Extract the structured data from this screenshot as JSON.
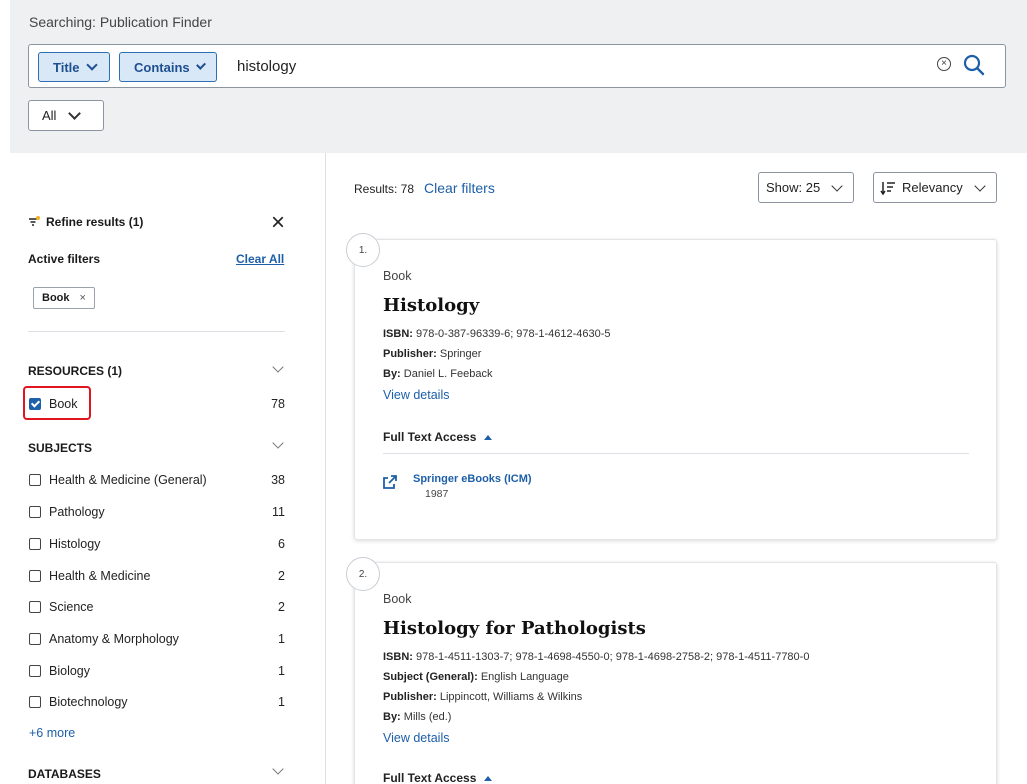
{
  "header": {
    "searching_label": "Searching: Publication Finder",
    "field_select": "Title",
    "operator_select": "Contains",
    "query": "histology",
    "clear_symbol": "⊗",
    "scope_select": "All"
  },
  "sidebar": {
    "refine_title": "Refine results (1)",
    "active_filters_label": "Active filters",
    "clear_all_label": "Clear All",
    "active_chip": "Book",
    "chip_remove": "×",
    "facets": [
      {
        "heading": "RESOURCES (1)",
        "items": [
          {
            "label": "Book",
            "count": "78",
            "checked": true
          }
        ]
      },
      {
        "heading": "SUBJECTS",
        "items": [
          {
            "label": "Health & Medicine (General)",
            "count": "38",
            "checked": false
          },
          {
            "label": "Pathology",
            "count": "11",
            "checked": false
          },
          {
            "label": "Histology",
            "count": "6",
            "checked": false
          },
          {
            "label": "Health & Medicine",
            "count": "2",
            "checked": false
          },
          {
            "label": "Science",
            "count": "2",
            "checked": false
          },
          {
            "label": "Anatomy & Morphology",
            "count": "1",
            "checked": false
          },
          {
            "label": "Biology",
            "count": "1",
            "checked": false
          },
          {
            "label": "Biotechnology",
            "count": "1",
            "checked": false
          }
        ],
        "more_label": "+6 more"
      },
      {
        "heading": "DATABASES"
      }
    ]
  },
  "results": {
    "count_label": "Results: 78",
    "clear_filters_label": "Clear filters",
    "show_label": "Show: 25",
    "sort_label": "Relevancy",
    "items": [
      {
        "number": "1.",
        "type": "Book",
        "title": "Histology",
        "meta": [
          {
            "key": "ISBN:",
            "value": "978-0-387-96339-6; 978-1-4612-4630-5"
          },
          {
            "key": "Publisher:",
            "value": "Springer"
          },
          {
            "key": "By:",
            "value": "Daniel L. Feeback"
          }
        ],
        "view_details": "View details",
        "full_text_label": "Full Text Access",
        "source_name": "Springer eBooks (ICM)",
        "source_year": "1987"
      },
      {
        "number": "2.",
        "type": "Book",
        "title": "Histology for Pathologists",
        "meta": [
          {
            "key": "ISBN:",
            "value": "978-1-4511-1303-7; 978-1-4698-4550-0; 978-1-4698-2758-2; 978-1-4511-7780-0"
          },
          {
            "key": "Subject (General):",
            "value": "English Language"
          },
          {
            "key": "Publisher:",
            "value": "Lippincott, Williams & Wilkins"
          },
          {
            "key": "By:",
            "value": "Mills (ed.)"
          }
        ],
        "view_details": "View details",
        "full_text_label": "Full Text Access"
      }
    ]
  },
  "colors": {
    "accent": "#1d5fa8",
    "highlight": "#e0151f",
    "panel_bg": "#eef0f2"
  },
  "icons": [
    "search-icon",
    "clear-icon",
    "filter-icon",
    "close-icon",
    "chevron-down-icon",
    "sort-icon",
    "external-link-icon",
    "caret-up-icon",
    "checkbox-icon"
  ]
}
